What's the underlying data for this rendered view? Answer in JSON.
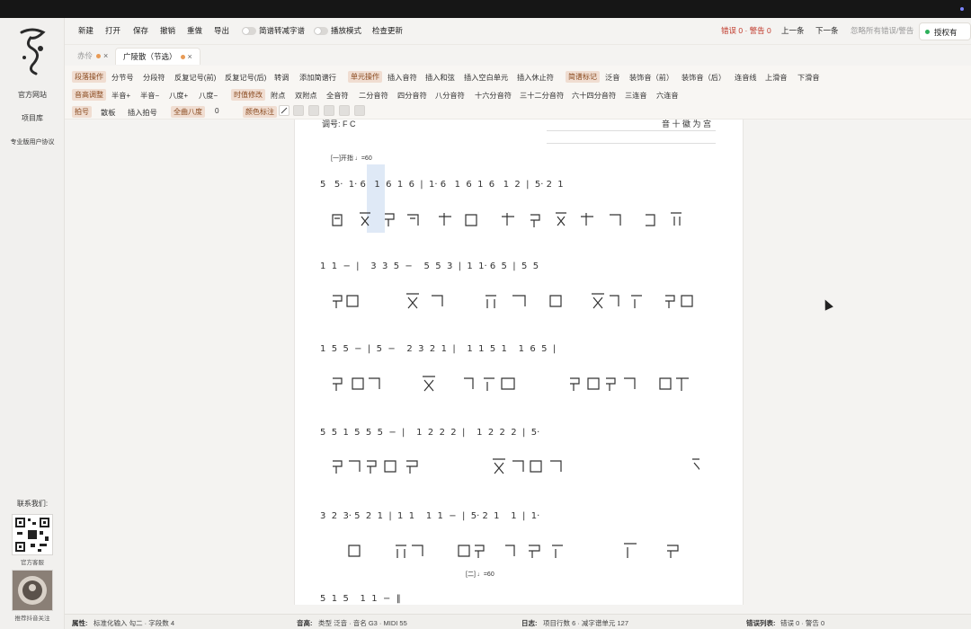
{
  "sidebar": {
    "links": [
      "官方网站",
      "项目库",
      "专业版用户协议"
    ],
    "contact_label": "联系我们:",
    "qr_captions": [
      "官方客服",
      "推荐抖音关注"
    ]
  },
  "menubar": {
    "items": [
      "新建",
      "打开",
      "保存",
      "撤销",
      "重做",
      "导出"
    ],
    "toggle1_label": "简谱转减字谱",
    "toggle2_label": "播放模式",
    "check_update": "检查更新",
    "error_status": "错误 0 · 警告 0",
    "prev": "上一条",
    "next": "下一条",
    "ignore_all": "忽略所有错误/警告",
    "license": "授权有效"
  },
  "tabs": [
    {
      "label": "赤伶",
      "active": false
    },
    {
      "label": "广陵散（节选）",
      "active": true
    }
  ],
  "toolbar": {
    "row1": {
      "cat1": "段落操作",
      "items1": [
        "分节号",
        "分段符",
        "反复记号(前)",
        "反复记号(后)",
        "转调",
        "添加简谱行"
      ],
      "cat2": "单元操作",
      "items2": [
        "插入音符",
        "插入和弦",
        "插入空白单元",
        "插入休止符"
      ],
      "cat3": "简谱标记",
      "items3": [
        "泛音",
        "装饰音（前）",
        "装饰音（后）",
        "连音线",
        "上滑音",
        "下滑音"
      ]
    },
    "row2": {
      "cat1": "音高调整",
      "items1": [
        "半音+",
        "半音−",
        "八度+",
        "八度−"
      ],
      "cat2": "时值修改",
      "items2": [
        "附点",
        "双附点",
        "全音符",
        "二分音符",
        "四分音符",
        "八分音符",
        "十六分音符",
        "三十二分音符",
        "六十四分音符",
        "三连音",
        "六连音"
      ]
    },
    "row3": {
      "cat1": "拍号",
      "items1": [
        "散板",
        "插入拍号"
      ],
      "cat2": "全曲八度",
      "octave_value": "0",
      "cat3": "颜色标注"
    }
  },
  "sheet": {
    "partial_top_left": "调号: F C",
    "partial_top_right": "音 十 徽 为 宫",
    "section1": "[一]开指 ♩=60",
    "section2": "[二] ♩=60",
    "rows": [
      "5   5·  1· 6   1  6  1  6  |  1· 6   1  6  1  6   1  2  |  5· 2  1",
      "1  1  −  |    3  3  5  −    5  5  3  |  1  1· 6  5  |  5  5",
      "1  5  5  −  |  5  −    2  3  2  1  |    1  1  5  1    1  6  5  |",
      "5  5  1  5  5  5  −  |    1  2  2  2  |    1  2  2  2  |  5·",
      "3  2  3· 5  2  1  |  1  1    1  1  −  |  5· 2  1    1  |  1·",
      "5  1  5    1  1  −  ‖"
    ]
  },
  "status": {
    "attr_label": "属性:",
    "attr_value": "标准化输入 勾二 · 字段数 4",
    "pitch_label": "音高:",
    "pitch_value": "类型 泛音 · 音名 G3 · MIDI 55",
    "log_label": "日志:",
    "log_value": "项目行数 6 · 减字谱单元 127",
    "errlist_label": "错误列表:",
    "errlist_value": "错误 0 · 警告 0"
  }
}
